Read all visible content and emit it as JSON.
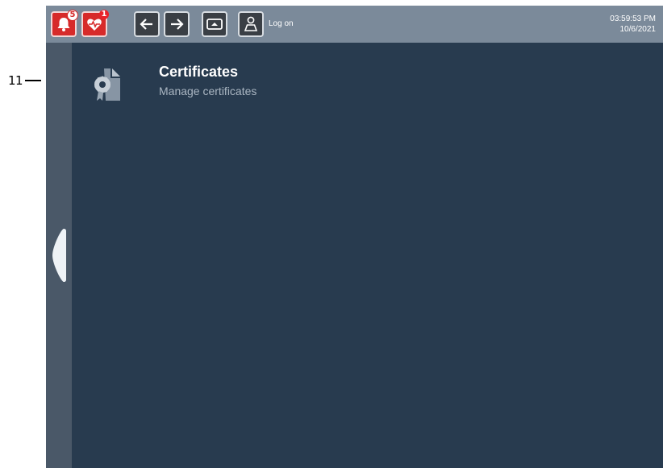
{
  "callout": {
    "number": "11"
  },
  "topbar": {
    "alarms_badge": "5",
    "health_badge": "1",
    "logon_label": "Log on",
    "time": "03:59:53 PM",
    "date": "10/6/2021"
  },
  "content": {
    "items": [
      {
        "title": "Certificates",
        "subtitle": "Manage certificates"
      }
    ]
  },
  "colors": {
    "screen_bg": "#283b4f",
    "topbar_bg": "#7b8a9a",
    "sidebar_bg": "#4a5868",
    "alert_red": "#d72a2a"
  }
}
